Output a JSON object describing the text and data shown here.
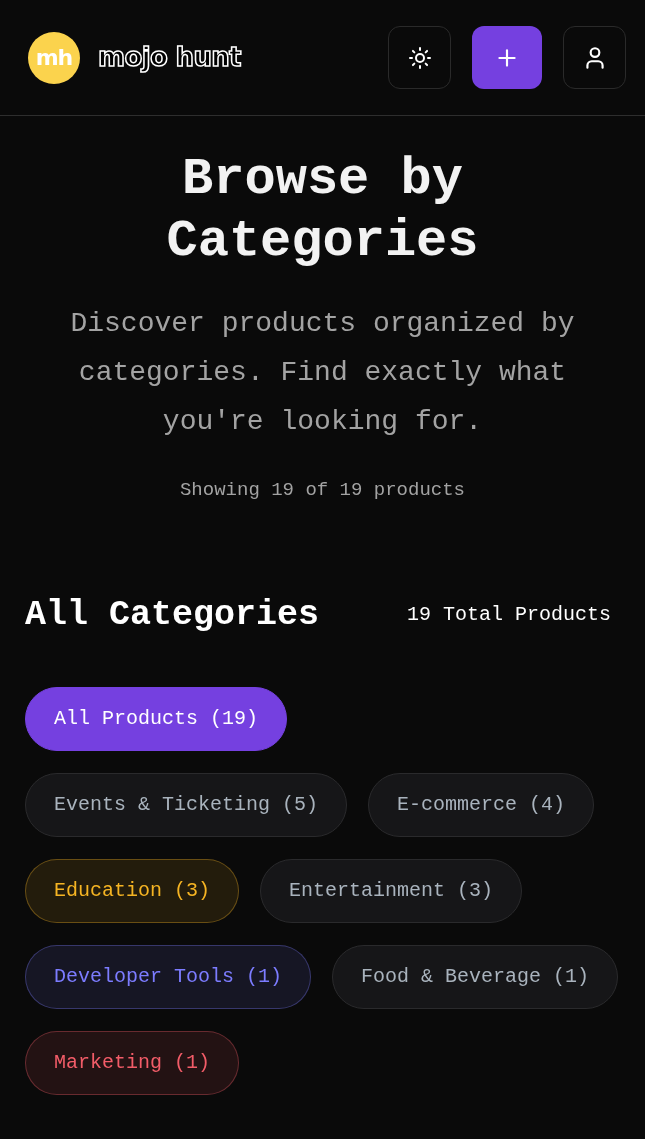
{
  "header": {
    "logo_mark": "mh",
    "logo_text": "mojo hunt",
    "buttons": [
      {
        "kind": "theme"
      },
      {
        "kind": "add"
      },
      {
        "kind": "profile"
      }
    ]
  },
  "hero": {
    "title": "Browse by Categories",
    "subtitle": "Discover products organized by categories. Find exactly what you're looking for.",
    "count": "Showing 19 of 19 products"
  },
  "section": {
    "title": "All Categories",
    "total": "19 Total Products"
  },
  "categories": [
    {
      "label": "All Products (19)",
      "selected": true
    },
    {
      "label": "Events & Ticketing (5)",
      "selected": false
    },
    {
      "label": "E-commerce (4)",
      "selected": false
    },
    {
      "label": "Education (3)",
      "selected": false,
      "color": "#f5b423"
    },
    {
      "label": "Entertainment (3)",
      "selected": false
    },
    {
      "label": "Developer Tools (1)",
      "selected": false,
      "color": "#7c7cff"
    },
    {
      "label": "Food & Beverage (1)",
      "selected": false
    },
    {
      "label": "Marketing (1)",
      "selected": false,
      "color": "#f25c68"
    }
  ]
}
